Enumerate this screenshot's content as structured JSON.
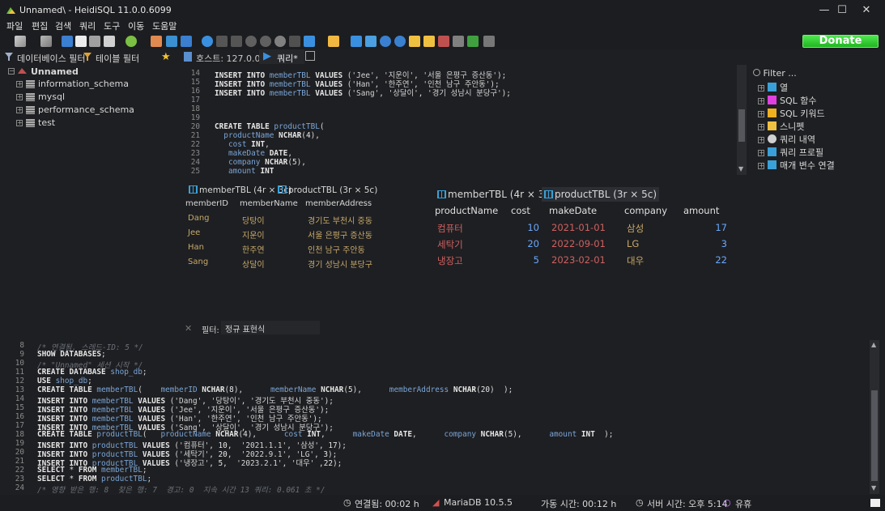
{
  "window": {
    "title": "Unnamed\\ - HeidiSQL 11.0.0.6099",
    "minimize": "—",
    "maximize": "☐",
    "close": "✕"
  },
  "menu": [
    "파일",
    "편집",
    "검색",
    "쿼리",
    "도구",
    "이동",
    "도움말"
  ],
  "toolbar": {
    "donate_label": "Donate"
  },
  "left_panel": {
    "db_filter_label": "데이터베이스 필터",
    "table_filter_label": "테이블 필터",
    "root": "Unnamed",
    "databases": [
      "information_schema",
      "mysql",
      "performance_schema",
      "test"
    ]
  },
  "query_tabs": {
    "host_label": "호스트: 127.0.0.1",
    "query_label": "쿼리*"
  },
  "editor_top": {
    "lines": [
      {
        "n": "14",
        "text": "INSERT INTO memberTBL VALUES ('Jee', '지운이', '서울 은평구 증산동');"
      },
      {
        "n": "15",
        "text": "INSERT INTO memberTBL VALUES ('Han', '한주연', '인천 남구 주안동');"
      },
      {
        "n": "16",
        "text": "INSERT INTO memberTBL VALUES ('Sang', '상달이', '경기 성남시 분당구');"
      },
      {
        "n": "17",
        "text": ""
      },
      {
        "n": "18",
        "text": ""
      },
      {
        "n": "19",
        "text": ""
      },
      {
        "n": "20",
        "text": "CREATE TABLE productTBL("
      },
      {
        "n": "21",
        "text": "  productName NCHAR(4),"
      },
      {
        "n": "22",
        "text": "   cost INT,"
      },
      {
        "n": "23",
        "text": "   makeDate DATE,"
      },
      {
        "n": "24",
        "text": "   company NCHAR(5),"
      },
      {
        "n": "25",
        "text": "   amount INT"
      }
    ]
  },
  "helper": {
    "filter_label": "Filter ...",
    "items": [
      "열",
      "SQL 함수",
      "SQL 키워드",
      "스니펫",
      "쿼리 내역",
      "쿼리 프로필",
      "매개 변수 연결"
    ]
  },
  "result_left": {
    "tabs": [
      "memberTBL (4r × 3c)",
      "productTBL (3r × 5c)"
    ],
    "columns": [
      "memberID",
      "memberName",
      "memberAddress"
    ],
    "rows": [
      [
        "Dang",
        "당탕이",
        "경기도 부천시 중동"
      ],
      [
        "Jee",
        "지운이",
        "서울 은평구 증산동"
      ],
      [
        "Han",
        "한주연",
        "인천 남구 주안동"
      ],
      [
        "Sang",
        "상달이",
        "경기 성남시 분당구"
      ]
    ]
  },
  "result_right": {
    "tabs": [
      "memberTBL (4r × 3c)",
      "productTBL (3r × 5c)"
    ],
    "columns": [
      "productName",
      "cost",
      "makeDate",
      "company",
      "amount"
    ],
    "rows": [
      [
        "컴퓨터",
        "10",
        "2021-01-01",
        "삼성",
        "17"
      ],
      [
        "세탁기",
        "20",
        "2022-09-01",
        "LG",
        "3"
      ],
      [
        "냉장고",
        "5",
        "2023-02-01",
        "대우",
        "22"
      ]
    ]
  },
  "filter_bar": {
    "label": "필터:",
    "value": "정규 표현식"
  },
  "log": {
    "lines": [
      {
        "n": "8",
        "text": "/* 연결됨. 스레드-ID: 5 */",
        "type": "cm"
      },
      {
        "n": "9",
        "text": "SHOW DATABASES;",
        "type": "code"
      },
      {
        "n": "10",
        "text": "/* \"Unnamed\" 세션 시작 */",
        "type": "cm"
      },
      {
        "n": "11",
        "text": "CREATE DATABASE shop_db;",
        "type": "code"
      },
      {
        "n": "12",
        "text": "USE shop_db;",
        "type": "code"
      },
      {
        "n": "13",
        "text": "CREATE TABLE memberTBL(    memberID NCHAR(8),      memberName NCHAR(5),      memberAddress NCHAR(20)  );",
        "type": "code"
      },
      {
        "n": "14",
        "text": "INSERT INTO memberTBL VALUES ('Dang', '당탕이', '경기도 부천시 중동');",
        "type": "code"
      },
      {
        "n": "15",
        "text": "INSERT INTO memberTBL VALUES ('Jee', '지운이', '서울 은평구 증산동');",
        "type": "code"
      },
      {
        "n": "16",
        "text": "INSERT INTO memberTBL VALUES ('Han', '한주연', '인천 남구 주안동');",
        "type": "code"
      },
      {
        "n": "17",
        "text": "INSERT INTO memberTBL VALUES ('Sang', '상달이', '경기 성남시 분당구');",
        "type": "code"
      },
      {
        "n": "18",
        "text": "CREATE TABLE productTBL(   productName NCHAR(4),      cost INT,      makeDate DATE,      company NCHAR(5),      amount INT  );",
        "type": "code"
      },
      {
        "n": "19",
        "text": "INSERT INTO productTBL VALUES ('컴퓨터', 10,  '2021.1.1', '삼성', 17);",
        "type": "code"
      },
      {
        "n": "20",
        "text": "INSERT INTO productTBL VALUES ('세탁기', 20,  '2022.9.1', 'LG', 3);",
        "type": "code"
      },
      {
        "n": "21",
        "text": "INSERT INTO productTBL VALUES ('냉장고', 5,  '2023.2.1', '대우' ,22);",
        "type": "code"
      },
      {
        "n": "22",
        "text": "SELECT * FROM memberTBL;",
        "type": "code"
      },
      {
        "n": "23",
        "text": "SELECT * FROM productTBL;",
        "type": "code"
      },
      {
        "n": "24",
        "text": "/* 영향 받은 행: 8  찾은 행: 7  경고: 0  지속 시간 13 쿼리: 0.061 초 */",
        "type": "cm"
      }
    ]
  },
  "status": {
    "connected": "연결됨: 00:02 h",
    "server": "MariaDB 10.5.5",
    "uptime": "가동 시간: 00:12 h",
    "server_time": "서버 시간: 오후 5:14",
    "idle": "유휴"
  },
  "colors": {
    "accent": "#3aa0d8",
    "grid_text_left": "#c7a96a",
    "grid_text_right": "#d06060",
    "number_blue": "#6aa8ff",
    "donate_green": "#33cc33"
  }
}
